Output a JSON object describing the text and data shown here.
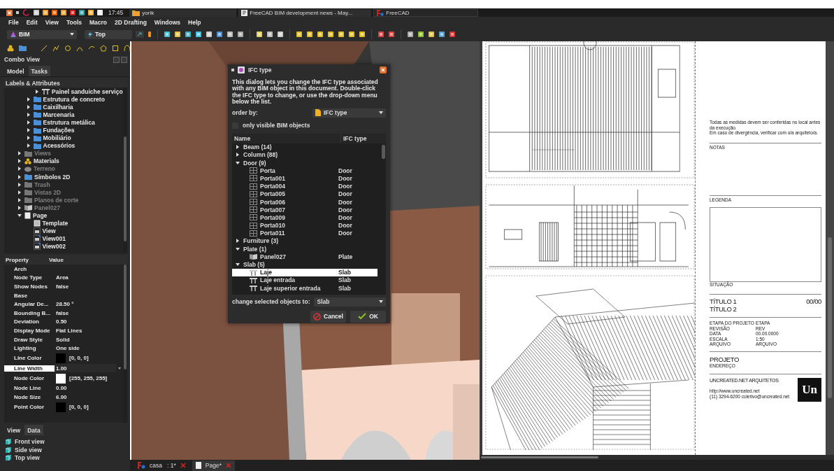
{
  "taskbar": {
    "time": "17:45",
    "folder": "yorik",
    "windows": [
      {
        "title": "FreeCAD BIM development news - May...",
        "kind": "browser",
        "selected": false
      },
      {
        "title": "FreeCAD",
        "kind": "freecad",
        "selected": true
      }
    ]
  },
  "menu": [
    "File",
    "Edit",
    "View",
    "Tools",
    "Macro",
    "2D Drafting",
    "Windows",
    "Help"
  ],
  "toolbar": {
    "workbench": "BIM",
    "view": "Top"
  },
  "combo_view": {
    "title": "Combo View",
    "tabs": [
      {
        "label": "Model",
        "selected": true
      },
      {
        "label": "Tasks",
        "selected": false
      }
    ],
    "tree_header": "Labels & Attributes",
    "tree": [
      {
        "children": [
          {
            "children": [
              {
                "label": "Painel sanduiche serviço",
                "kind": "slab",
                "expanded": false,
                "hidden": false
              }
            ]
          },
          {
            "label": "Estrutura de concreto",
            "kind": "folder",
            "expanded": false,
            "hidden": false
          },
          {
            "label": "Caixilharia",
            "kind": "folder",
            "expanded": false,
            "hidden": false
          },
          {
            "label": "Marcenaria",
            "kind": "folder",
            "expanded": false,
            "hidden": false
          },
          {
            "label": "Estrutura metálica",
            "kind": "folder",
            "expanded": false,
            "hidden": false
          },
          {
            "label": "Fundações",
            "kind": "folder",
            "expanded": false,
            "hidden": false
          },
          {
            "label": "Mobiliário",
            "kind": "folder",
            "expanded": false,
            "hidden": false
          },
          {
            "label": "Acessórios",
            "kind": "folder",
            "expanded": false,
            "hidden": false
          }
        ]
      },
      {
        "label": "Views",
        "kind": "folder",
        "expanded": false,
        "hidden": true
      },
      {
        "label": "Materials",
        "kind": "materials",
        "expanded": false,
        "hidden": false
      },
      {
        "label": "Terreno",
        "kind": "shape",
        "expanded": false,
        "hidden": true
      },
      {
        "label": "Símbolos 2D",
        "kind": "folder",
        "expanded": false,
        "hidden": false
      },
      {
        "label": "Trash",
        "kind": "folder",
        "expanded": false,
        "hidden": true
      },
      {
        "label": "Vistas 2D",
        "kind": "folder",
        "expanded": false,
        "hidden": true
      },
      {
        "label": "Planos de corte",
        "kind": "folder",
        "expanded": false,
        "hidden": true
      },
      {
        "label": "Panel027",
        "kind": "panel",
        "expanded": false,
        "hidden": true
      },
      {
        "label": "Page",
        "kind": "page",
        "expanded": true,
        "hidden": false,
        "children": [
          {
            "label": "Template",
            "kind": "template",
            "hidden": false
          },
          {
            "label": "View",
            "kind": "view",
            "hidden": false
          },
          {
            "label": "View001",
            "kind": "view-marked",
            "hidden": false
          },
          {
            "label": "View002",
            "kind": "view-marked",
            "hidden": false
          }
        ]
      }
    ]
  },
  "properties": {
    "columns": [
      "Property",
      "Value"
    ],
    "rows": [
      {
        "kind": "group",
        "name": "Arch"
      },
      {
        "kind": "prop",
        "name": "Node Type",
        "value": "Area",
        "selected": false
      },
      {
        "kind": "prop",
        "name": "Show Nodes",
        "value": "false",
        "selected": false
      },
      {
        "kind": "group",
        "name": "Base"
      },
      {
        "kind": "prop",
        "name": "Angular De...",
        "value": "28.50 °",
        "selected": false
      },
      {
        "kind": "prop",
        "name": "Bounding B...",
        "value": "false",
        "selected": false
      },
      {
        "kind": "prop",
        "name": "Deviation",
        "value": "0.50",
        "selected": false
      },
      {
        "kind": "prop",
        "name": "Display Mode",
        "value": "Flat Lines",
        "selected": false
      },
      {
        "kind": "prop",
        "name": "Draw Style",
        "value": "Solid",
        "selected": false
      },
      {
        "kind": "prop",
        "name": "Lighting",
        "value": "One side",
        "selected": false
      },
      {
        "kind": "color",
        "name": "Line Color",
        "value": "[0, 0, 0]",
        "color": "#000000",
        "selected": false
      },
      {
        "kind": "prop",
        "name": "Line Width",
        "value": "1.00",
        "selected": true
      },
      {
        "kind": "color",
        "name": "Node Color",
        "value": "[255, 255, 255]",
        "color": "#ffffff",
        "selected": false
      },
      {
        "kind": "prop",
        "name": "Node Line",
        "value": "0.00",
        "selected": false
      },
      {
        "kind": "prop",
        "name": "Node Size",
        "value": "6.00",
        "selected": false
      },
      {
        "kind": "color",
        "name": "Point Color",
        "value": "[0, 0, 0]",
        "color": "#000000",
        "selected": false
      }
    ]
  },
  "view_tabs": [
    {
      "label": "View",
      "selected": true
    },
    {
      "label": "Data",
      "selected": false
    }
  ],
  "views": [
    "Front view",
    "Side view",
    "Top view"
  ],
  "dialog": {
    "title": "IFC type",
    "description": "This dialog lets you change the IFC type associated with any BIM object in this document. Double-click the IFC type to change, or use the drop-down menu below the list.",
    "order_label": "order by:",
    "order_value": "IFC type",
    "only_visible": {
      "label": "only visible BIM objects",
      "checked": false
    },
    "columns": [
      "Name",
      "IFC type"
    ],
    "groups": [
      {
        "label": "Beam (14)",
        "expanded": false
      },
      {
        "label": "Column (88)",
        "expanded": false
      },
      {
        "label": "Door (9)",
        "expanded": true,
        "children": [
          {
            "name": "Porta",
            "type": "Door",
            "kind": "door",
            "selected": false
          },
          {
            "name": "Porta001",
            "type": "Door",
            "kind": "door",
            "selected": false
          },
          {
            "name": "Porta004",
            "type": "Door",
            "kind": "door",
            "selected": false
          },
          {
            "name": "Porta005",
            "type": "Door",
            "kind": "door",
            "selected": false
          },
          {
            "name": "Porta006",
            "type": "Door",
            "kind": "door",
            "selected": false
          },
          {
            "name": "Porta007",
            "type": "Door",
            "kind": "door",
            "selected": false
          },
          {
            "name": "Porta009",
            "type": "Door",
            "kind": "door",
            "selected": false
          },
          {
            "name": "Porta010",
            "type": "Door",
            "kind": "door",
            "selected": false
          },
          {
            "name": "Porta011",
            "type": "Door",
            "kind": "door",
            "selected": false
          }
        ]
      },
      {
        "label": "Furniture (3)",
        "expanded": false
      },
      {
        "label": "Plate (1)",
        "expanded": true,
        "children": [
          {
            "name": "Panel027",
            "type": "Plate",
            "kind": "panel",
            "selected": false
          }
        ]
      },
      {
        "label": "Slab (5)",
        "expanded": true,
        "children": [
          {
            "name": "Laje",
            "type": "Slab",
            "kind": "slab",
            "selected": true
          },
          {
            "name": "Laje entrada",
            "type": "Slab",
            "kind": "slab",
            "selected": false
          },
          {
            "name": "Laje superior entrada",
            "type": "Slab",
            "kind": "slab",
            "selected": false
          }
        ]
      }
    ],
    "change_label": "change selected objects to:",
    "change_value": "Slab",
    "buttons": [
      {
        "label": "Cancel",
        "kind": "cancel"
      },
      {
        "label": "OK",
        "kind": "ok"
      }
    ]
  },
  "sheet": {
    "notice": [
      "Todas as medidas devem ser conferidas no local antes da execução.",
      "Em caso de divergência, verificar com o/a arquiteto/a."
    ],
    "notes": "NOTAS",
    "legend": "LEGENDA",
    "situation": "SITUAÇÃO",
    "titles": [
      "TÍTULO 1",
      "TÍTULO 2"
    ],
    "sheet_number": "00/00",
    "info": [
      {
        "label": "ETAPA DO PROJETO",
        "value": "ETAPA"
      },
      {
        "label": "REVISÃO",
        "value": "REV"
      },
      {
        "label": "DATA",
        "value": "00.00.0000"
      },
      {
        "label": "ESCALA",
        "value": "1:50"
      },
      {
        "label": "ARQUIVO",
        "value": "ARQUIVO"
      }
    ],
    "project": "PROJETO",
    "address": "ENDEREÇO",
    "office": "UNCREATED.NET ARQUITETOS",
    "logo": "Un",
    "url": "http://www.uncreated.net",
    "contact": "(11) 3294-6200  coletivo@uncreated.net"
  },
  "doc_tabs": [
    {
      "label": "casa   : 1*",
      "kind": "model",
      "selected": false
    },
    {
      "label": "Page*",
      "kind": "page",
      "selected": true
    }
  ]
}
